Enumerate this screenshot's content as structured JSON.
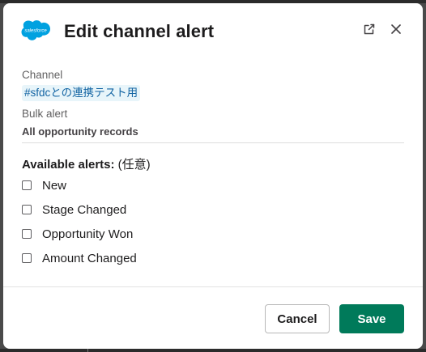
{
  "modal": {
    "logo_text": "salesforce",
    "title": "Edit channel alert"
  },
  "channel": {
    "label": "Channel",
    "value": "#sfdcとの連携テスト用"
  },
  "bulk": {
    "label": "Bulk alert",
    "value": "All opportunity records"
  },
  "alerts": {
    "heading_bold": "Available alerts:",
    "heading_note": " (任意)",
    "options": [
      {
        "label": "New",
        "checked": false
      },
      {
        "label": "Stage Changed",
        "checked": false
      },
      {
        "label": "Opportunity Won",
        "checked": false
      },
      {
        "label": "Amount Changed",
        "checked": false
      }
    ]
  },
  "footer": {
    "cancel_label": "Cancel",
    "save_label": "Save"
  },
  "colors": {
    "save_button": "#007a5a",
    "channel_link": "#1264a3",
    "salesforce_blue": "#00a1e0"
  },
  "icons": {
    "open": "external-link-icon",
    "close": "close-icon",
    "logo": "salesforce-logo"
  }
}
